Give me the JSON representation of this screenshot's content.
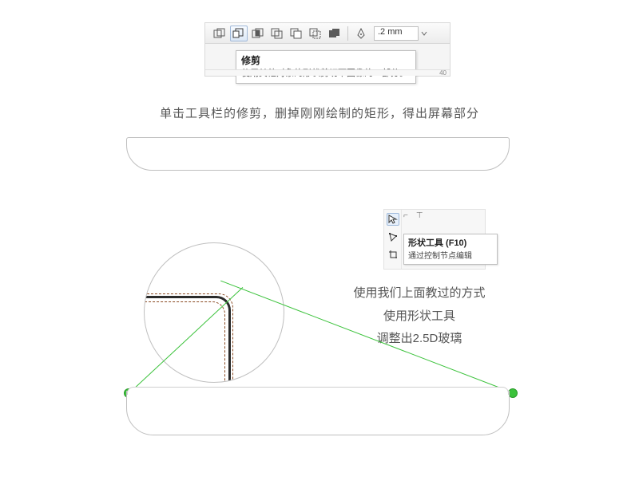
{
  "toolbar": {
    "outline_width": ".2 mm",
    "ruler_label": "40",
    "trim_tooltip": {
      "title": "修剪",
      "body": "使用其他对象的形状剪切下图像的一部分。"
    }
  },
  "caption_trim": "单击工具栏的修剪，删掉刚刚绘制的矩形，得出屏幕部分",
  "shape_tool": {
    "title": "形状工具 (F10)",
    "body": "通过控制节点编辑"
  },
  "caption_shape": {
    "line1": "使用我们上面教过的方式",
    "line2": "使用形状工具",
    "line3": "调整出2.5D玻璃"
  }
}
